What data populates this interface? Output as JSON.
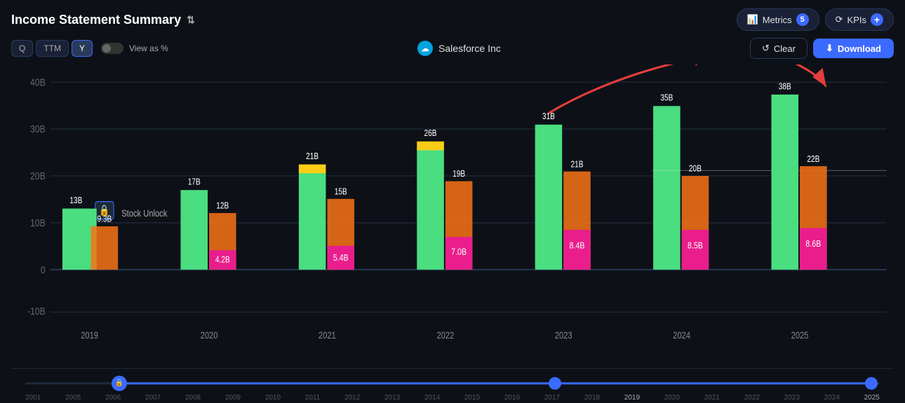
{
  "title": "Income Statement Summary",
  "header": {
    "metrics_label": "Metrics",
    "metrics_count": "5",
    "kpis_label": "KPIs"
  },
  "controls": {
    "periods": [
      "Q",
      "TTM",
      "Y"
    ],
    "active_period": "Y",
    "view_as_pct_label": "View as %",
    "company_name": "Salesforce Inc",
    "clear_label": "Clear",
    "download_label": "Download"
  },
  "chart": {
    "y_axis_labels": [
      "40B",
      "30B",
      "20B",
      "10B",
      "0",
      "-10B"
    ],
    "bars": [
      {
        "year": "2019",
        "total_label": "13B",
        "green_height_pct": 35,
        "orange_height_pct": 28,
        "pink_height_pct": 8,
        "orange_label": "9.3B",
        "pink_label": null
      },
      {
        "year": "2020",
        "total_label": "17B",
        "green_height_pct": 43,
        "orange_height_pct": 31,
        "pink_height_pct": 5,
        "orange_label": "12B",
        "pink_label": "4.2B"
      },
      {
        "year": "2021",
        "total_label": "21B",
        "green_height_pct": 53,
        "orange_height_pct": 38,
        "pink_height_pct": 10,
        "orange_label": "15B",
        "pink_label": "5.4B"
      },
      {
        "year": "2022",
        "total_label": "26B",
        "green_height_pct": 64,
        "orange_height_pct": 47,
        "pink_height_pct": 12,
        "orange_label": "19B",
        "pink_label": "7.0B"
      },
      {
        "year": "2023",
        "total_label": "31B",
        "green_height_pct": 77,
        "orange_height_pct": 52,
        "pink_height_pct": 15,
        "orange_label": "21B",
        "pink_label": "8.4B"
      },
      {
        "year": "2024",
        "total_label": "35B",
        "green_height_pct": 86,
        "orange_height_pct": 50,
        "pink_height_pct": 15,
        "orange_label": "20B",
        "pink_label": "8.5B"
      },
      {
        "year": "2025",
        "total_label": "38B",
        "green_height_pct": 93,
        "orange_height_pct": 53,
        "pink_height_pct": 15,
        "orange_label": "22B",
        "pink_label": "8.6B"
      }
    ],
    "yellow_bar_years": [
      "2021",
      "2022"
    ],
    "stock_unlock_label": "Stock Unlock"
  },
  "timeline": {
    "years": [
      "2001",
      "2005",
      "2006",
      "2007",
      "2008",
      "2009",
      "2010",
      "2011",
      "2012",
      "2013",
      "2014",
      "2015",
      "2016",
      "2017",
      "2018",
      "2019",
      "2020",
      "2021",
      "2022",
      "2023",
      "2024",
      "2025"
    ]
  }
}
